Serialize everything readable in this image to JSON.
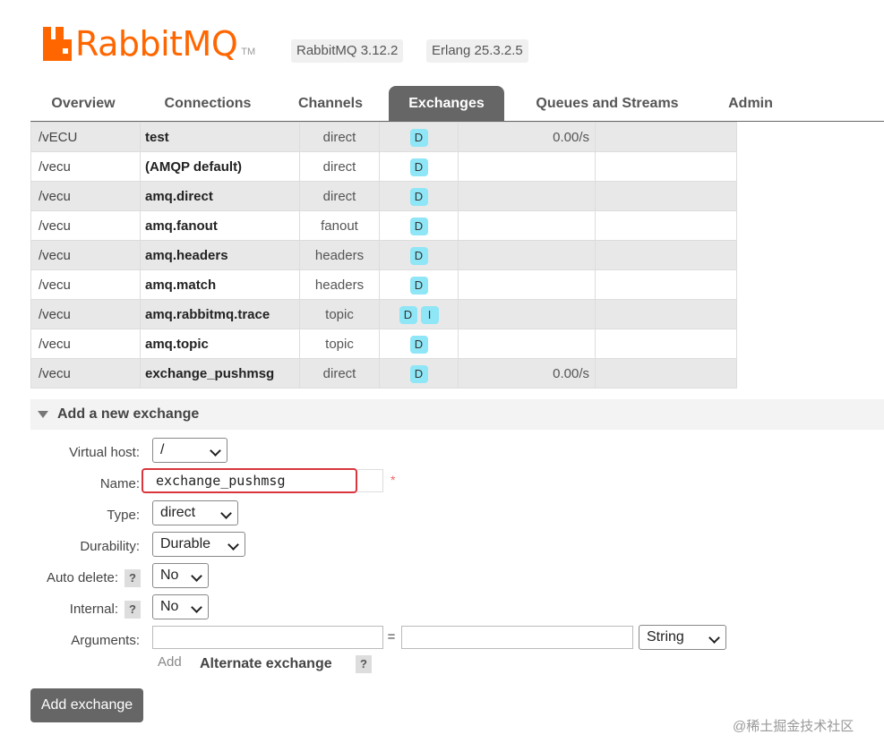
{
  "header": {
    "logo_text": "RabbitMQ",
    "logo_tm": "TM",
    "version": "RabbitMQ 3.12.2",
    "erlang": "Erlang 25.3.2.5"
  },
  "tabs": [
    "Overview",
    "Connections",
    "Channels",
    "Exchanges",
    "Queues and Streams",
    "Admin"
  ],
  "active_tab": "Exchanges",
  "exchanges": [
    {
      "vhost": "/vECU",
      "name": "test",
      "type": "direct",
      "features": [
        "D"
      ],
      "rate_in": "0.00/s",
      "rate_out": ""
    },
    {
      "vhost": "/vecu",
      "name": "(AMQP default)",
      "type": "direct",
      "features": [
        "D"
      ],
      "rate_in": "",
      "rate_out": ""
    },
    {
      "vhost": "/vecu",
      "name": "amq.direct",
      "type": "direct",
      "features": [
        "D"
      ],
      "rate_in": "",
      "rate_out": ""
    },
    {
      "vhost": "/vecu",
      "name": "amq.fanout",
      "type": "fanout",
      "features": [
        "D"
      ],
      "rate_in": "",
      "rate_out": ""
    },
    {
      "vhost": "/vecu",
      "name": "amq.headers",
      "type": "headers",
      "features": [
        "D"
      ],
      "rate_in": "",
      "rate_out": ""
    },
    {
      "vhost": "/vecu",
      "name": "amq.match",
      "type": "headers",
      "features": [
        "D"
      ],
      "rate_in": "",
      "rate_out": ""
    },
    {
      "vhost": "/vecu",
      "name": "amq.rabbitmq.trace",
      "type": "topic",
      "features": [
        "D",
        "I"
      ],
      "rate_in": "",
      "rate_out": ""
    },
    {
      "vhost": "/vecu",
      "name": "amq.topic",
      "type": "topic",
      "features": [
        "D"
      ],
      "rate_in": "",
      "rate_out": ""
    },
    {
      "vhost": "/vecu",
      "name": "exchange_pushmsg",
      "type": "direct",
      "features": [
        "D"
      ],
      "rate_in": "0.00/s",
      "rate_out": ""
    }
  ],
  "add_section": {
    "title": "Add a new exchange",
    "virtual_host_label": "Virtual host:",
    "virtual_host_value": "/",
    "name_label": "Name:",
    "name_value": "exchange_pushmsg",
    "required_mark": "*",
    "type_label": "Type:",
    "type_value": "direct",
    "durability_label": "Durability:",
    "durability_value": "Durable",
    "auto_delete_label": "Auto delete:",
    "auto_delete_value": "No",
    "internal_label": "Internal:",
    "internal_value": "No",
    "arguments_label": "Arguments:",
    "equals": "=",
    "arg_type_value": "String",
    "help_mark": "?",
    "add_link": "Add",
    "alternate_exchange": "Alternate exchange",
    "submit": "Add exchange"
  },
  "footer_watermark": "@稀土掘金技术社区",
  "colors": {
    "brand": "#ff6600",
    "tab_active": "#666666",
    "feature_badge": "#8ee6f6",
    "highlight_border": "#d9363e"
  }
}
